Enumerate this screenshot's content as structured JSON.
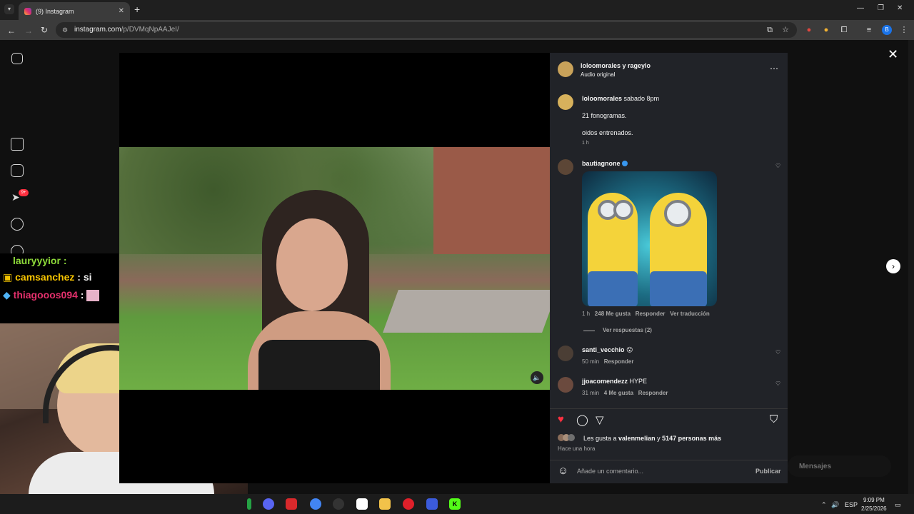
{
  "browser": {
    "tab_title": "(9) Instagram",
    "tab_close": "✕",
    "new_tab": "+",
    "url_host": "instagram.com",
    "url_path": "/p/DVMqNpAAJeI/",
    "profile_letter": "B"
  },
  "sidebar": {
    "notification_badge": "9+"
  },
  "chat": {
    "lines": [
      {
        "user": "lauryyyior",
        "sep": " :",
        "msg": ""
      },
      {
        "user": "camsanchez",
        "sep": " :",
        "msg": " si"
      },
      {
        "user": "thiagooos094",
        "sep": " :",
        "msg": ""
      }
    ],
    "colors": {
      "line1": "#8fdc3a",
      "line2": "#f1f1f1",
      "line3": "#e3306c"
    }
  },
  "post": {
    "header_users": "loloomorales y rageylo",
    "header_audio": "Audio original",
    "caption": {
      "user": "loloomorales",
      "line1": "sabado 8pm",
      "line2": "21 fonogramas.",
      "line3": "oidos entrenados.",
      "time": "1 h"
    },
    "comments": [
      {
        "user": "bautiagnone",
        "verified": true,
        "text": "",
        "time": "1 h",
        "likes": "248 Me gusta",
        "reply": "Responder",
        "translate": "Ver traducción",
        "view_replies": "Ver respuestas (2)"
      },
      {
        "user": "santi_vecchio",
        "text": "😮",
        "time": "50 min",
        "reply": "Responder"
      },
      {
        "user": "jjoacomendezz",
        "text": "HYPE",
        "time": "31 min",
        "likes": "4 Me gusta",
        "reply": "Responder"
      }
    ],
    "likes_text_pre": "Les gusta a ",
    "likes_user": "valenmelian",
    "likes_text_mid": " y ",
    "likes_count": "5147 personas más",
    "posted_ago": "Hace una hora",
    "comment_placeholder": "Añade un comentario...",
    "publish_label": "Publicar"
  },
  "messages_pill": "Mensajes",
  "taskbar": {
    "lang": "ESP",
    "time": "9:09 PM",
    "date": "2/25/2026"
  }
}
